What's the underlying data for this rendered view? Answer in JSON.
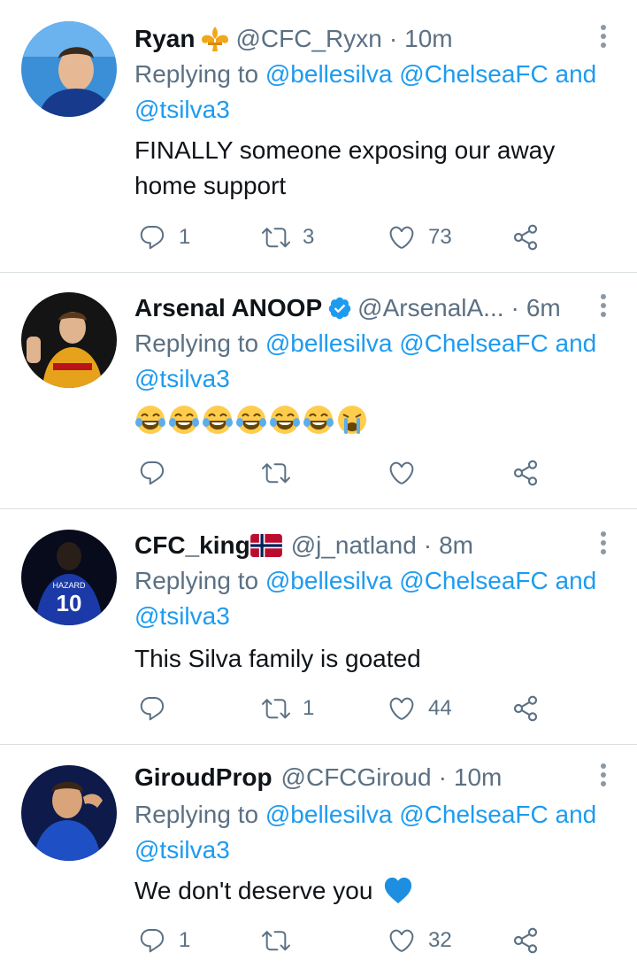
{
  "tweets": [
    {
      "name": "Ryan",
      "handle": "@CFC_Ryxn",
      "separator": "·",
      "time": "10m",
      "badge_icon": "fleur-de-lis-icon",
      "replying_prefix": "Replying to ",
      "mention1": "@bellesilva",
      "mention2": "@ChelseaFC",
      "conjunction": " and",
      "mention3": "@tsilva3",
      "text_line1": "FINALLY someone exposing our away",
      "text_line2": "home support",
      "replies": "1",
      "retweets": "3",
      "likes": "73"
    },
    {
      "name": "Arsenal ANOOP",
      "handle": "@ArsenalA...",
      "separator": "·",
      "time": "6m",
      "badge_icon": "verified-check-icon",
      "replying_prefix": "Replying to ",
      "mention1": "@bellesilva",
      "mention2": "@ChelseaFC",
      "conjunction": " and",
      "mention3": "@tsilva3",
      "emoji": [
        "laughing-crying-emoji",
        "laughing-crying-emoji",
        "laughing-crying-emoji",
        "laughing-crying-emoji",
        "laughing-crying-emoji",
        "laughing-crying-emoji",
        "loudly-crying-emoji"
      ],
      "replies": "",
      "retweets": "",
      "likes": ""
    },
    {
      "name": "CFC_king",
      "handle": "@j_natland",
      "separator": "·",
      "time": "8m",
      "badge_icon": "norway-flag-icon",
      "replying_prefix": "Replying to ",
      "mention1": "@bellesilva",
      "mention2": "@ChelseaFC",
      "conjunction": " and",
      "mention3": "@tsilva3",
      "text_line1": "This Silva family is goated",
      "replies": "",
      "retweets": "1",
      "likes": "44"
    },
    {
      "name": "GiroudProp",
      "handle": "@CFCGiroud",
      "separator": "·",
      "time": "10m",
      "replying_prefix": "Replying to ",
      "mention1": "@bellesilva",
      "mention2": "@ChelseaFC",
      "conjunction": " and",
      "mention3": "@tsilva3",
      "text_line1": "We don't deserve you",
      "text_emoji": "blue-heart-emoji",
      "replies": "1",
      "retweets": "",
      "likes": "32"
    }
  ],
  "colors": {
    "text": "#0f1419",
    "secondary": "#5b7083",
    "link": "#1d9bf0",
    "divider": "#d9dee2"
  }
}
